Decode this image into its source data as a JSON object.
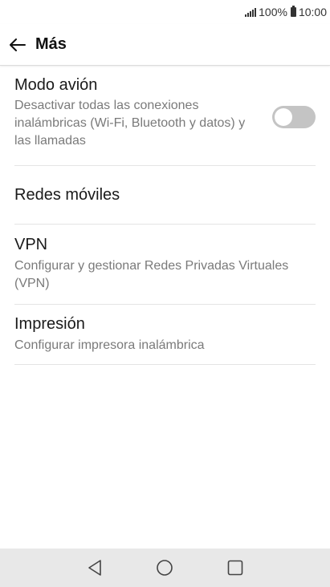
{
  "status_bar": {
    "battery": "100%",
    "time": "10:00",
    "icons": [
      "signal-icon",
      "battery-icon"
    ]
  },
  "app_bar": {
    "title": "Más",
    "back_icon": "arrow-left-icon"
  },
  "settings": [
    {
      "id": "airplane",
      "title": "Modo avión",
      "subtitle": "Desactivar todas las conexiones inalámbricas (Wi-Fi, Bluetooth y datos) y las llamadas",
      "toggle_on": false
    },
    {
      "id": "mobile",
      "title": "Redes móviles"
    },
    {
      "id": "vpn",
      "title": "VPN",
      "subtitle": "Configurar y gestionar Redes Privadas Virtuales (VPN)"
    },
    {
      "id": "print",
      "title": "Impresión",
      "subtitle": "Configurar impresora inalámbrica"
    }
  ],
  "nav_bar": {
    "icons": [
      "back-triangle-icon",
      "home-circle-icon",
      "recents-square-icon"
    ]
  },
  "colors": {
    "toggle_off": "#c4c4c4",
    "subtitle": "#7a7a7a",
    "nav_background": "#e8e8e8"
  }
}
